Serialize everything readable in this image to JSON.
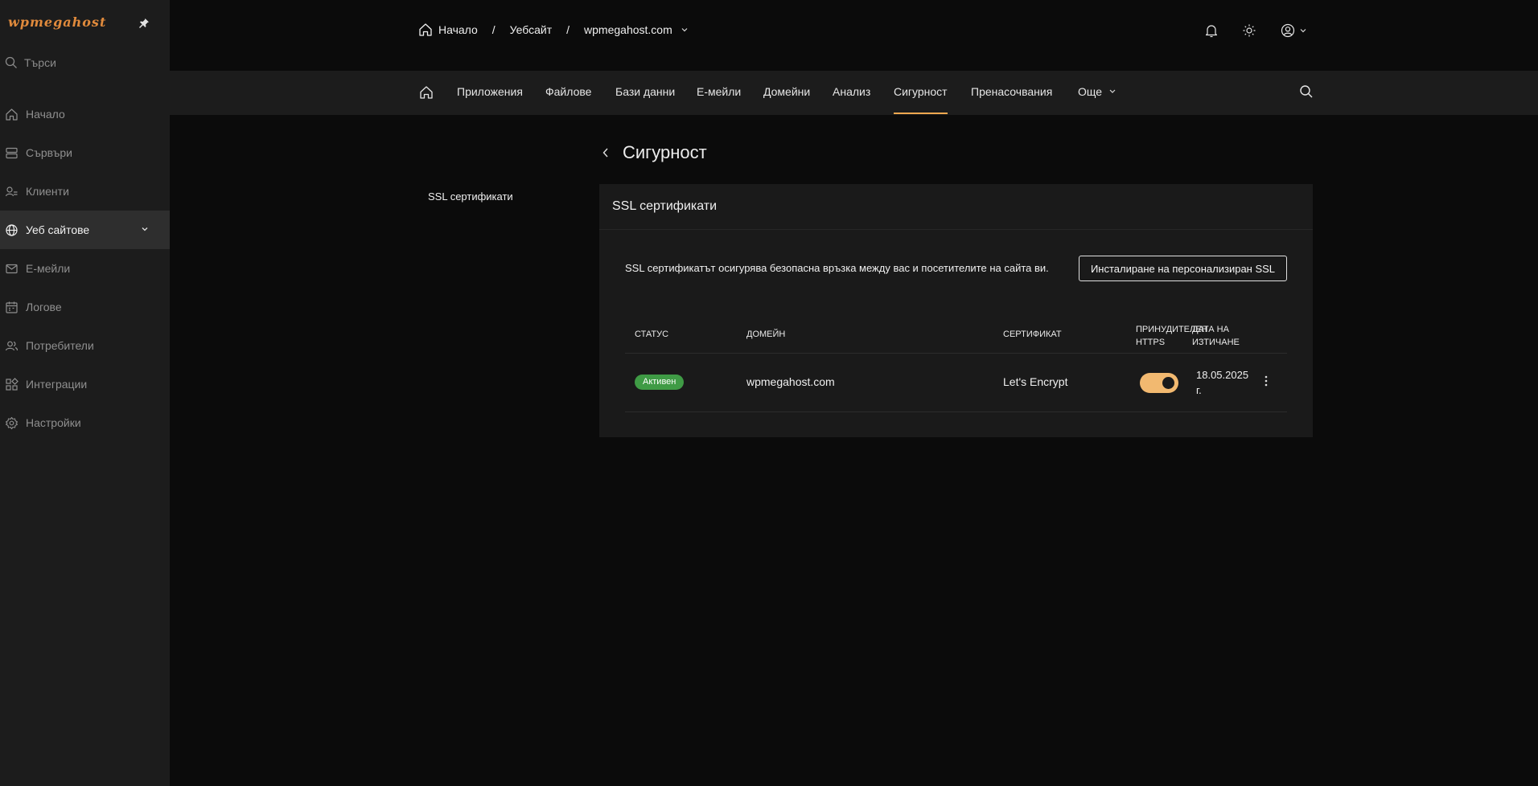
{
  "sidebar": {
    "logo": "wpmegahost",
    "search_placeholder": "Търси",
    "items": [
      {
        "label": "Начало",
        "icon": "home-icon"
      },
      {
        "label": "Сървъри",
        "icon": "server-icon"
      },
      {
        "label": "Клиенти",
        "icon": "clients-icon"
      },
      {
        "label": "Уеб сайтове",
        "icon": "globe-icon",
        "active": true
      },
      {
        "label": "Е-мейли",
        "icon": "mail-icon"
      },
      {
        "label": "Логове",
        "icon": "calendar-icon"
      },
      {
        "label": "Потребители",
        "icon": "users-icon"
      },
      {
        "label": "Интеграции",
        "icon": "grid-icon"
      },
      {
        "label": "Настройки",
        "icon": "gear-icon"
      }
    ]
  },
  "breadcrumb": {
    "home": "Начало",
    "section": "Уебсайт",
    "site": "wpmegahost.com",
    "separator": "/"
  },
  "tabs": {
    "items": [
      "Приложения",
      "Файлове",
      "Бази данни",
      "Е-мейли",
      "Домейни",
      "Анализ",
      "Сигурност",
      "Пренасочвания",
      "Още"
    ],
    "active": "Сигурност"
  },
  "page": {
    "title": "Сигурност",
    "left_menu_item": "SSL сертификати"
  },
  "card": {
    "title": "SSL сертификати",
    "description": "SSL сертификатът осигурява безопасна връзка между вас и посетителите на сайта ви.",
    "install_button": "Инсталиране на персонализиран SSL",
    "columns": {
      "status": "СТАТУС",
      "domain": "ДОМЕЙН",
      "certificate": "СЕРТИФИКАТ",
      "force_https_1": "ПРИНУДИТЕЛЕН",
      "force_https_2": "HTTPS",
      "expiry_1": "ДАТА НА",
      "expiry_2": "ИЗТИЧАНЕ"
    },
    "rows": [
      {
        "status": "Активен",
        "domain": "wpmegahost.com",
        "certificate": "Let's Encrypt",
        "force_https": true,
        "expiry_1": "18.05.2025",
        "expiry_2": "г."
      }
    ]
  },
  "colors": {
    "accent": "#f0a850",
    "toggle_on": "#f2b970",
    "badge_active": "#3f9b45",
    "logo": "#e08a3c"
  }
}
